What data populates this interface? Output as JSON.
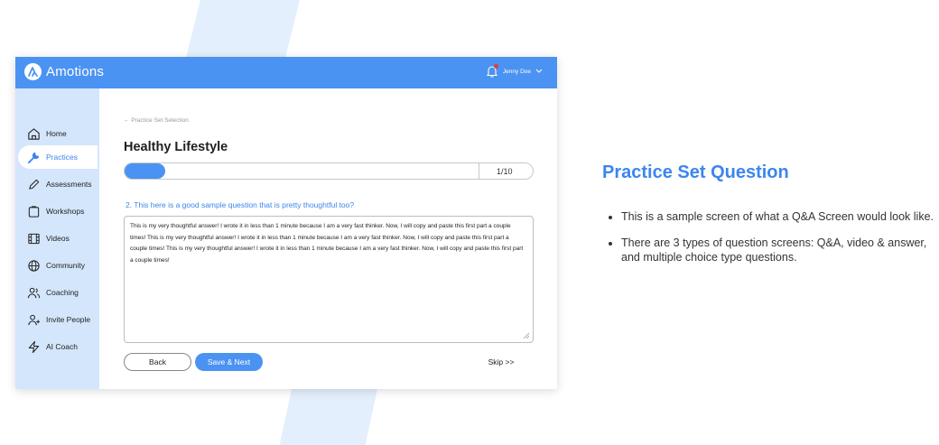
{
  "app": {
    "name": "Amotions"
  },
  "user": {
    "name": "Jenny Doe"
  },
  "sidebar": {
    "items": [
      {
        "label": "Home",
        "icon": "home-icon"
      },
      {
        "label": "Practices",
        "icon": "wrench-icon",
        "active": true
      },
      {
        "label": "Assessments",
        "icon": "pencil-icon"
      },
      {
        "label": "Workshops",
        "icon": "clipboard-icon"
      },
      {
        "label": "Videos",
        "icon": "film-icon"
      },
      {
        "label": "Community",
        "icon": "globe-icon"
      },
      {
        "label": "Coaching",
        "icon": "people-icon"
      },
      {
        "label": "Invite People",
        "icon": "add-user-icon"
      },
      {
        "label": "AI Coach",
        "icon": "lightning-icon"
      }
    ]
  },
  "main": {
    "back_link": "← Practice Set Selection",
    "title": "Healthy Lifestyle",
    "progress": {
      "current": 1,
      "total": 10,
      "label": "1/10"
    },
    "question": "2. This here is a good sample question that is pretty thoughtful too?",
    "answer": "This is my very thoughtful answer! I wrote it in less than 1 minute because I am a very fast thinker. Now, I will copy and paste this first part a couple times! This is my very thoughtful answer! I wrote it in less than 1 minute because I am a very fast thinker. Now, I will copy and paste this first part a couple times! This is my very thoughtful answer! I wrote it in less than 1 minute because I am a very fast thinker. Now, I will copy and paste this first part a couple times!",
    "buttons": {
      "back": "Back",
      "next": "Save & Next",
      "skip": "Skip >>"
    }
  },
  "description": {
    "title": "Practice Set Question",
    "bullets": [
      "This is a sample screen of what a Q&A Screen would look like.",
      "There are 3 types of question screens: Q&A, video & answer, and multiple choice type questions."
    ]
  },
  "colors": {
    "accent": "#4b93f2",
    "sidebar": "#d4e6fb",
    "heading": "#3b86ee"
  }
}
